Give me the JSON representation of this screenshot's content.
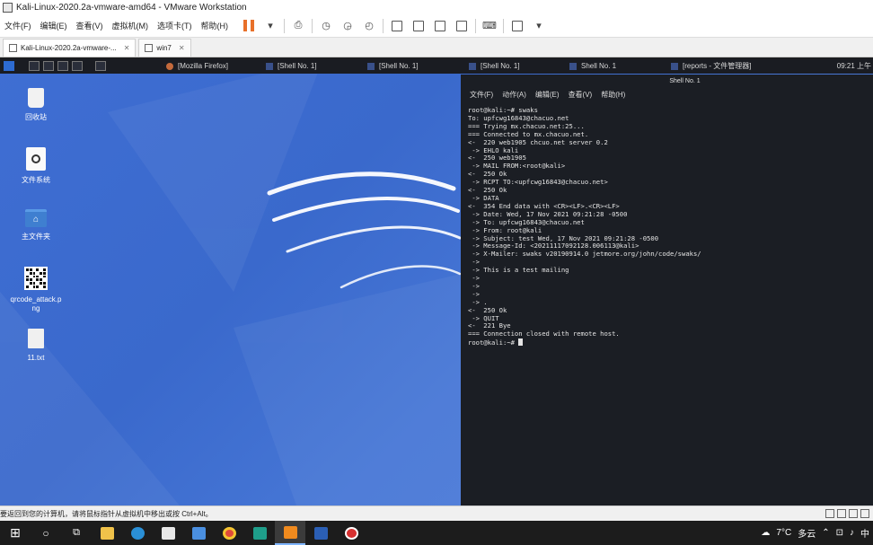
{
  "window": {
    "title": "Kali-Linux-2020.2a-vmware-amd64 - VMware Workstation"
  },
  "menu": [
    "文件(F)",
    "编辑(E)",
    "查看(V)",
    "虚拟机(M)",
    "选项卡(T)",
    "帮助(H)"
  ],
  "vm_tabs": [
    {
      "label": "Kali-Linux-2020.2a-vmware-...",
      "active": true
    },
    {
      "label": "win7",
      "active": false
    }
  ],
  "panel": {
    "tasks": [
      "[Mozilla Firefox]",
      "[Shell No. 1]",
      "[Shell No. 1]",
      "[Shell No. 1]",
      "Shell No. 1",
      "[reports - 文件管理器]"
    ],
    "clock": "09:21 上午"
  },
  "desktop_icons": [
    {
      "label": "回收站",
      "icon": "trash-icon"
    },
    {
      "label": "文件系统",
      "icon": "drive-icon"
    },
    {
      "label": "主文件夹",
      "icon": "home-folder-icon"
    },
    {
      "label": "qrcode_attack.png",
      "icon": "qrcode-icon"
    },
    {
      "label": "11.txt",
      "icon": "text-file-icon"
    }
  ],
  "terminal": {
    "title": "Shell No. 1",
    "menu": [
      "文件(F)",
      "动作(A)",
      "编辑(E)",
      "查看(V)",
      "帮助(H)"
    ],
    "lines": [
      "root@kali:~# swaks",
      "To: upfcwg16843@chacuo.net",
      "=== Trying mx.chacuo.net:25...",
      "=== Connected to mx.chacuo.net.",
      "<-  220 web1905 chcuo.net server 0.2",
      " -> EHLO kali",
      "<-  250 web1905",
      " -> MAIL FROM:<root@kali>",
      "<-  250 Ok",
      " -> RCPT TO:<upfcwg16843@chacuo.net>",
      "<-  250 Ok",
      " -> DATA",
      "<-  354 End data with <CR><LF>.<CR><LF>",
      " -> Date: Wed, 17 Nov 2021 09:21:28 -0500",
      " -> To: upfcwg16843@chacuo.net",
      " -> From: root@kali",
      " -> Subject: test Wed, 17 Nov 2021 09:21:28 -0500",
      " -> Message-Id: <20211117092128.006113@kali>",
      " -> X-Mailer: swaks v20190914.0 jetmore.org/john/code/swaks/",
      " ->",
      " -> This is a test mailing",
      " ->",
      " ->",
      " ->",
      " -> .",
      "<-  250 Ok",
      " -> QUIT",
      "<-  221 Bye",
      "=== Connection closed with remote host.",
      "root@kali:~# "
    ]
  },
  "status_bar": {
    "text": "要返回到您的计算机，请将鼠标指针从虚拟机中移出或按 Ctrl+Alt。"
  },
  "taskbar": {
    "apps": [
      "file-explorer-icon",
      "edge-icon",
      "store-icon",
      "mail-icon",
      "chrome-icon",
      "terminal-app-icon",
      "vmware-icon",
      "word-icon",
      "recorder-icon"
    ],
    "temperature": "7°C",
    "weather": "多云",
    "ime": "中"
  }
}
